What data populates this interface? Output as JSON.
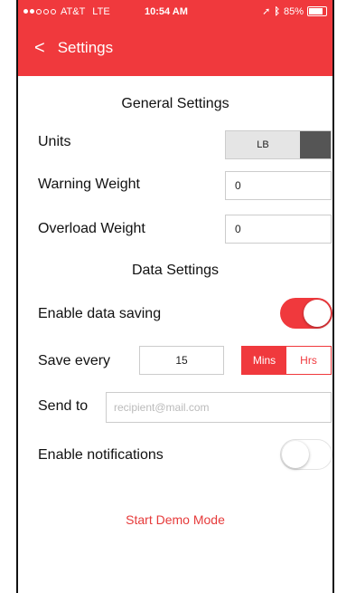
{
  "status_bar": {
    "carrier": "AT&T",
    "network": "LTE",
    "time": "10:54 AM",
    "battery": "85%",
    "battery_level": 0.85
  },
  "nav": {
    "title": "Settings",
    "back_icon": "chevron-left-icon"
  },
  "general": {
    "header": "General Settings",
    "units_label": "Units",
    "units_value": "LB",
    "warning_label": "Warning Weight",
    "warning_value": "0",
    "overload_label": "Overload Weight",
    "overload_value": "0"
  },
  "data_settings": {
    "header": "Data Settings",
    "enable_saving_label": "Enable data saving",
    "enable_saving_on": true,
    "save_every_label": "Save every",
    "save_every_value": "15",
    "unit_options": [
      "Mins",
      "Hrs"
    ],
    "selected_unit": "Mins",
    "send_to_label": "Send to",
    "send_to_placeholder": "recipient@mail.com",
    "notifications_label": "Enable notifications",
    "notifications_on": false
  },
  "demo_link": "Start Demo Mode",
  "colors": {
    "accent": "#f0393d",
    "toggle_off_border": "#e3e3e3"
  }
}
